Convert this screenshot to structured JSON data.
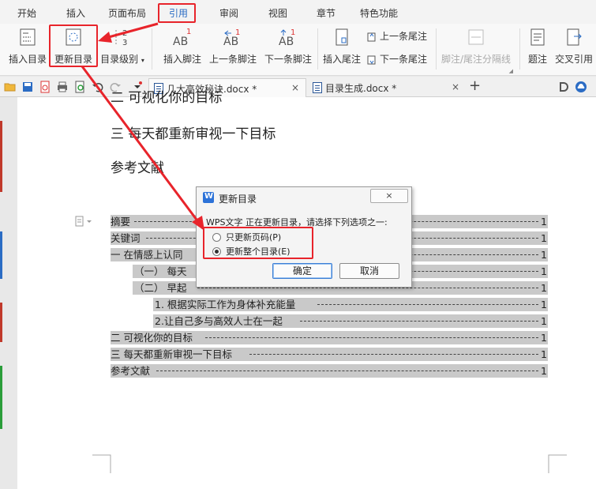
{
  "menu": {
    "tabs": [
      {
        "label": "开始"
      },
      {
        "label": "插入"
      },
      {
        "label": "页面布局"
      },
      {
        "label": "引用",
        "active": true
      },
      {
        "label": "审阅"
      },
      {
        "label": "视图"
      },
      {
        "label": "章节"
      },
      {
        "label": "特色功能"
      }
    ]
  },
  "ribbon": {
    "insert_toc": "插入目录",
    "update_toc": "更新目录",
    "toc_level": "目录级别",
    "insert_footnote": "插入脚注",
    "prev_footnote": "上一条脚注",
    "next_footnote": "下一条脚注",
    "insert_endnote": "插入尾注",
    "prev_endnote": "上一条尾注",
    "next_endnote": "下一条尾注",
    "note_separator": "脚注/尾注分隔线",
    "caption": "题注",
    "cross_ref": "交叉引用",
    "icon_text": {
      "ab": "AB",
      "one": "1",
      "two": "2",
      "three": "3"
    }
  },
  "tabs": {
    "doc1": "几大高效秘诀.docx *",
    "doc2": "目录生成.docx *",
    "close": "×",
    "add": "+"
  },
  "document": {
    "heading_partial": "二 可视化你的目标",
    "heading_3": "三  每天都重新审视一下目标",
    "heading_ref": "参考文献",
    "toc": [
      {
        "text": "摘要",
        "page": "1"
      },
      {
        "text": "关键词",
        "page": "1"
      },
      {
        "text": "一  在情感上认同",
        "page": "1"
      },
      {
        "text": "（一）  每天",
        "page": "1"
      },
      {
        "text": "（二）  早起",
        "page": "1"
      },
      {
        "text": "1. 根据实际工作为身体补充能量",
        "page": "1"
      },
      {
        "text": "2.让自己多与高效人士在一起",
        "page": "1"
      },
      {
        "text": "二  可视化你的目标",
        "page": "1"
      },
      {
        "text": "三  每天都重新审视一下目标",
        "page": "1"
      },
      {
        "text": "参考文献",
        "page": "1"
      }
    ]
  },
  "dialog": {
    "title": "更新目录",
    "message": "WPS文字 正在更新目录，请选择下列选项之一:",
    "option_page": "只更新页码(P)",
    "option_full": "更新整个目录(E)",
    "ok": "确定",
    "cancel": "取消",
    "selected": "option_full"
  },
  "colors": {
    "highlight": "#e8242b",
    "active_tab": "#2b6cc4",
    "toc_shade": "#c9c9c9"
  }
}
